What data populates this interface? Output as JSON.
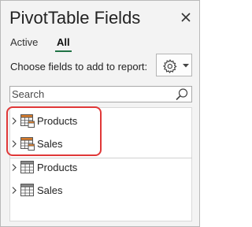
{
  "panel": {
    "title": "PivotTable Fields",
    "close_icon": "close-icon"
  },
  "tabs": [
    {
      "label": "Active",
      "selected": false
    },
    {
      "label": "All",
      "selected": true
    }
  ],
  "prompt": "Choose fields to add to report:",
  "tools_button": {
    "icon": "gear-icon",
    "dropdown_icon": "caret-down-icon"
  },
  "search": {
    "placeholder": "Search",
    "value": "",
    "icon": "search-icon"
  },
  "colors": {
    "accent": "#217346",
    "highlight": "#e03838",
    "table_icon_orange": "#d87c2a"
  },
  "fields": {
    "data_model_tables": [
      {
        "label": "Products",
        "icon": "data-model-table-icon"
      },
      {
        "label": "Sales",
        "icon": "data-model-table-icon"
      }
    ],
    "tables": [
      {
        "label": "Products",
        "icon": "table-icon"
      },
      {
        "label": "Sales",
        "icon": "table-icon"
      }
    ]
  }
}
